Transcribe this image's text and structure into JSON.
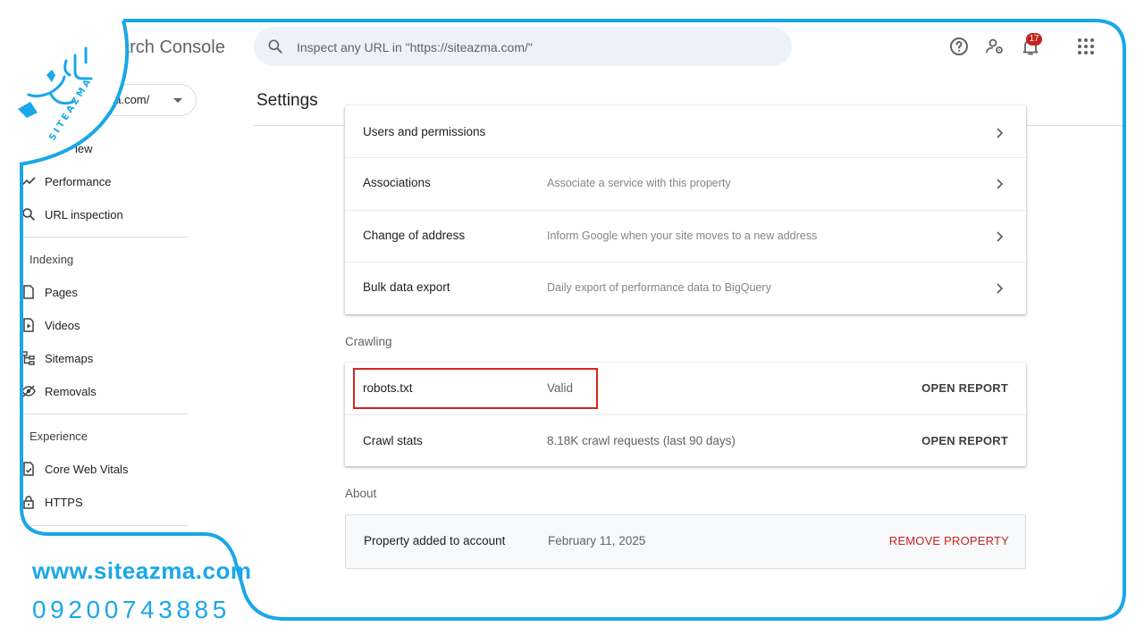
{
  "header": {
    "app_title_partial": "arch Console",
    "search_placeholder": "Inspect any URL in \"https://siteazma.com/\"",
    "notification_count": "17",
    "icons": [
      "search-icon",
      "help-icon",
      "manage-users-icon",
      "notifications-icon",
      "apps-grid-icon"
    ]
  },
  "property": {
    "selected": "na.com/"
  },
  "sidebar": {
    "overview_partial": "iew",
    "items_top": [
      {
        "label": "Performance",
        "icon": "trending-up-icon"
      },
      {
        "label": "URL inspection",
        "icon": "search-icon"
      }
    ],
    "indexing": {
      "title": "Indexing",
      "items": [
        {
          "label": "Pages",
          "icon": "pages-icon"
        },
        {
          "label": "Videos",
          "icon": "video-icon"
        },
        {
          "label": "Sitemaps",
          "icon": "sitemap-icon"
        },
        {
          "label": "Removals",
          "icon": "removals-icon"
        }
      ]
    },
    "experience": {
      "title": "Experience",
      "items": [
        {
          "label": "Core Web Vitals",
          "icon": "gauge-icon"
        },
        {
          "label": "HTTPS",
          "icon": "lock-icon"
        }
      ]
    }
  },
  "main": {
    "page_title": "Settings",
    "general_rows": [
      {
        "title": "Users and permissions",
        "desc": ""
      },
      {
        "title": "Associations",
        "desc": "Associate a service with this property"
      },
      {
        "title": "Change of address",
        "desc": "Inform Google when your site moves to a new address"
      },
      {
        "title": "Bulk data export",
        "desc": "Daily export of performance data to BigQuery"
      }
    ],
    "crawling": {
      "title": "Crawling",
      "rows": [
        {
          "title": "robots.txt",
          "desc": "Valid",
          "action": "OPEN REPORT"
        },
        {
          "title": "Crawl stats",
          "desc": "8.18K crawl requests (last 90 days)",
          "action": "OPEN REPORT"
        }
      ]
    },
    "about": {
      "title": "About",
      "row": {
        "title": "Property added to account",
        "value": "February 11, 2025",
        "action": "REMOVE PROPERTY"
      }
    }
  },
  "brand": {
    "logo_text": "SITEAZMA",
    "url": "www.siteazma.com",
    "phone": "09200743885",
    "accent_color": "#1aa7e8"
  },
  "colors": {
    "highlight": "#d5251c",
    "danger": "#c5221f",
    "search_bg": "#edf2fa"
  }
}
